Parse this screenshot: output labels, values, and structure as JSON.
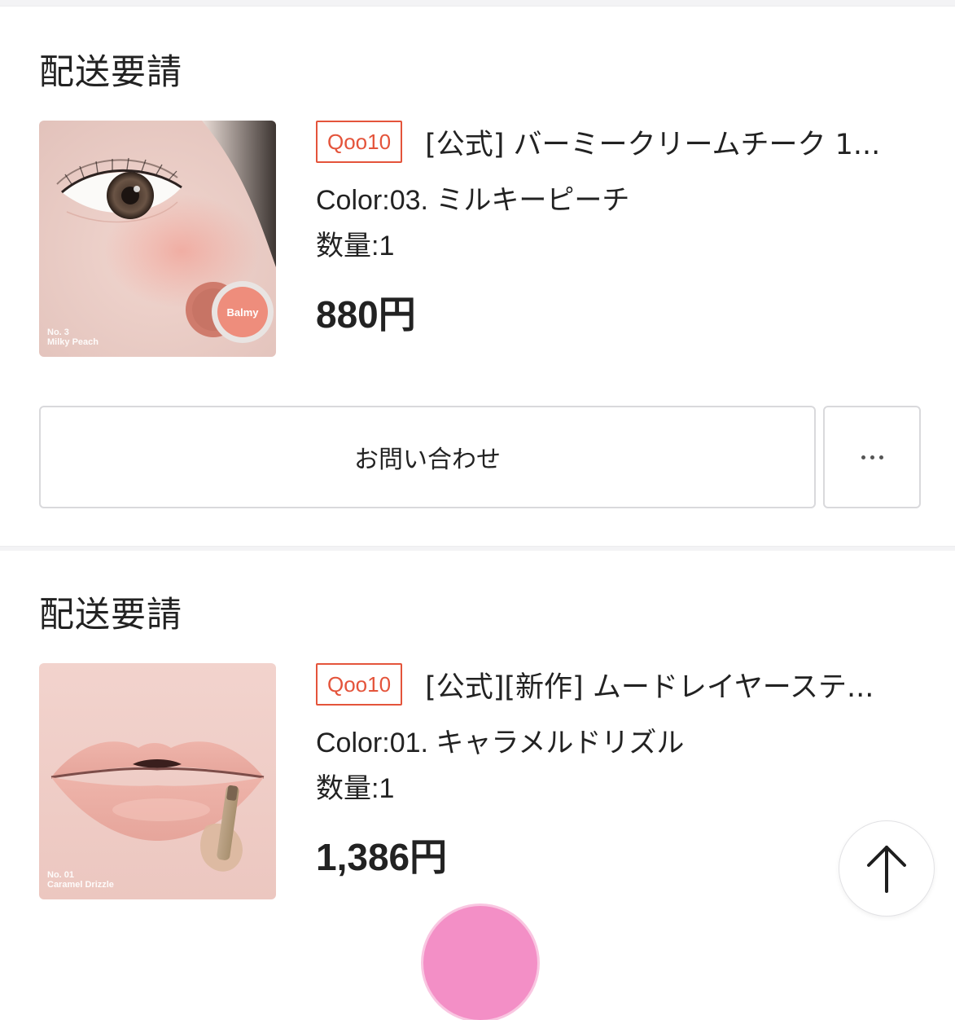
{
  "orders": [
    {
      "status": "配送要請",
      "shop_badge": "Qoo10",
      "product_name": "[公式] バーミークリームチーク 1...",
      "color_option": "Color:03. ミルキーピーチ",
      "quantity": "数量:1",
      "price": "880円",
      "image": {
        "name": "balmy-cream-cheek-milky-peach",
        "caption_line1": "No. 3",
        "caption_line2": "Milky Peach",
        "jar_label": "Balmy"
      },
      "actions": {
        "inquiry_label": "お問い合わせ",
        "more_icon": "ellipsis-icon"
      }
    },
    {
      "status": "配送要請",
      "shop_badge": "Qoo10",
      "product_name": "[公式][新作] ムードレイヤーステ...",
      "color_option": "Color:01. キャラメルドリズル",
      "quantity": "数量:1",
      "price": "1,386円",
      "image": {
        "name": "mood-layer-stick-caramel-drizzle",
        "caption_line1": "No. 01",
        "caption_line2": "Caramel Drizzle"
      }
    }
  ],
  "scroll_top_icon": "arrow-up-icon",
  "colors": {
    "badge": "#e4543b",
    "text": "#222222",
    "border": "#d9d9dc",
    "divider": "#f3f3f5",
    "fab": "#f38fc6"
  }
}
